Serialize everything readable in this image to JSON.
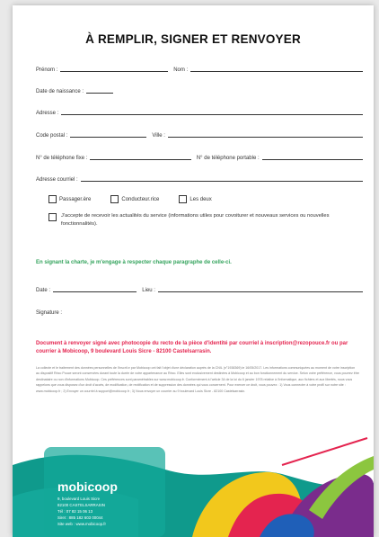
{
  "title": "À REMPLIR, SIGNER ET RENVOYER",
  "fields": {
    "prenom": "Prénom :",
    "nom": "Nom :",
    "date_naissance": "Date de naissance :",
    "adresse": "Adresse :",
    "code_postal": "Code postal :",
    "ville": "Ville :",
    "tel_fixe": "N° de téléphone fixe :",
    "tel_portable": "N° de téléphone portable :",
    "courriel": "Adresse courriel :"
  },
  "roles": [
    "Passager.ère",
    "Conducteur.rice",
    "Les deux"
  ],
  "consent": "J'accepte de recevoir les actualités du service (informations utiles pour covoiturer et nouveaux services ou nouvelles fonctionnalités).",
  "charter": "En signant la charte, je m'engage à respecter chaque paragraphe de celle-ci.",
  "sign": {
    "date": "Date :",
    "lieu": "Lieu :",
    "signature": "Signature :"
  },
  "send_notice": "Document à renvoyer signé avec photocopie du recto de la pièce d'identité par courriel à inscription@rezopouce.fr ou par courrier à Mobicoop, 9 boulevard Louis Sicre - 82100 Castelsarrasin.",
  "legal": "La collecte et le traitement des données personnelles de l'inscrit.e par Mobicoop ont fait l'objet d'une déclaration auprès de la CNIL (n°1938369) le 16/05/2017. Les informations communiquées au moment de votre inscription au dispositif Rézo Pouce seront conservées durant toute la durée de votre appartenance au Rézo. Elles sont exclusivement destinées à Mobicoop et au bon fonctionnement du service. Selon votre préférence, vous pourrez être destinataire ou non d'informations Mobicoop. Ces préférences sont paramétrables sur www.mobicoop.fr. Conformément à l'article 34 de la loi du 6 janvier 1978 relative à l'informatique, aux fichiers et aux libertés, nous vous rappelons que vous disposez d'un droit d'accès, de modification, de rectification et de suppression des données qui vous concernent. Pour exercer ce droit, vous pouvez : 1) Vous connecter à votre profil sur notre site : www.mobicoop.fr ; 2) Envoyer un courriel à support@mobicoop.fr ; 3) Nous envoyer un courrier au 9 boulevard Louis Sicre - 82100 Castelsarrasin.",
  "footer": {
    "logo": "mobicoop",
    "address": [
      "9, boulevard Louis Sicre",
      "82100 CASTELSARRASIN",
      "Tél : 07 82 15 06 13",
      "Siret : 885 182 603 00044",
      "Site web : www.mobicoop.fr"
    ]
  },
  "colors": {
    "green": "#33a35c",
    "pink": "#e4244f",
    "teal": "#0f9a8c"
  }
}
